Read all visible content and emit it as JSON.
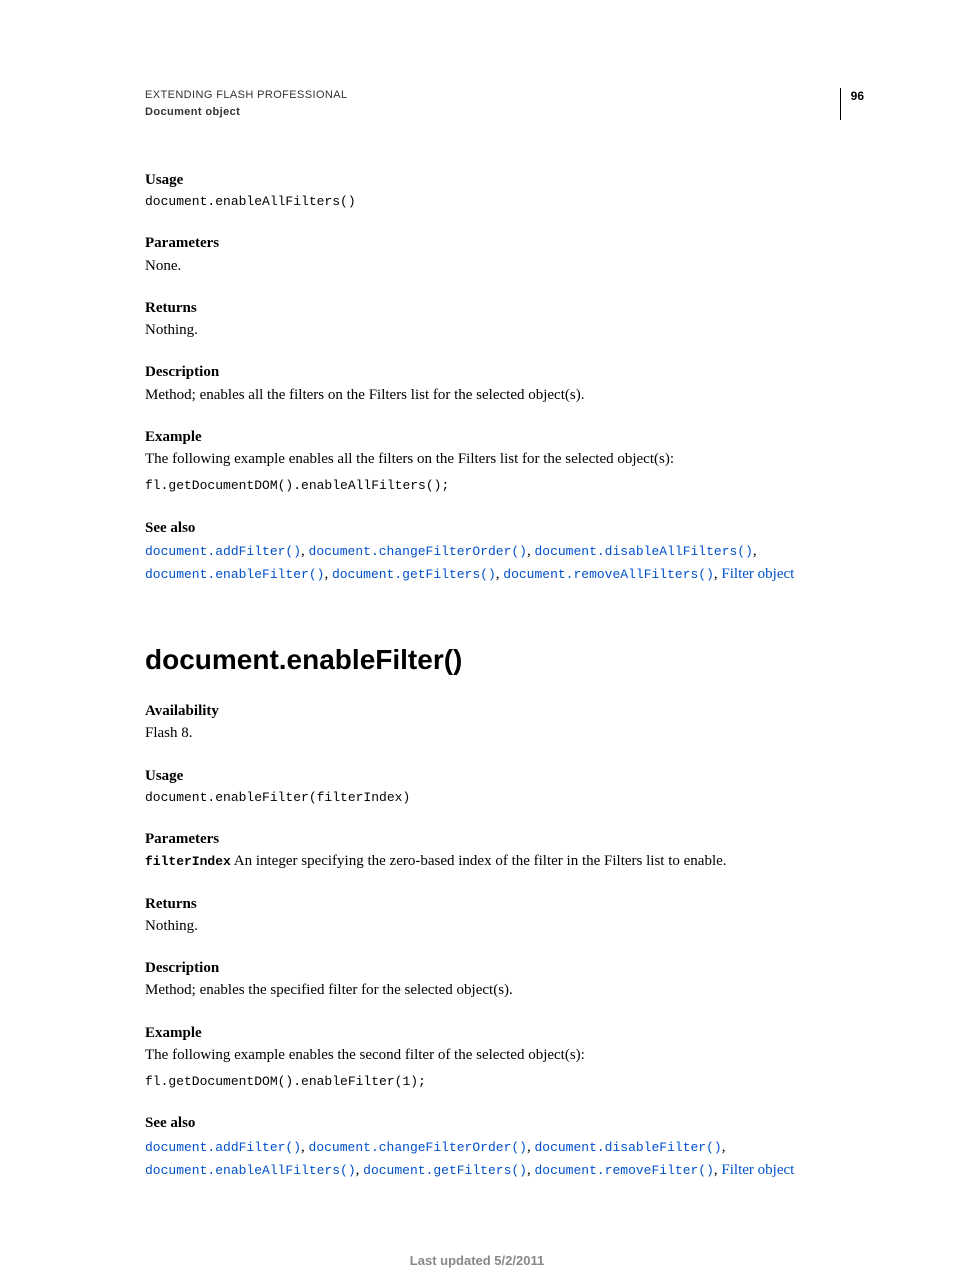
{
  "header": {
    "running_head": "EXTENDING FLASH PROFESSIONAL",
    "subhead": "Document object",
    "page_num": "96"
  },
  "sec1": {
    "usage_label": "Usage",
    "usage_code": "document.enableAllFilters()",
    "parameters_label": "Parameters",
    "parameters_text": "None.",
    "returns_label": "Returns",
    "returns_text": "Nothing.",
    "description_label": "Description",
    "description_text": "Method; enables all the filters on the Filters list for the selected object(s).",
    "example_label": "Example",
    "example_text": "The following example enables all the filters on the Filters list for the selected object(s):",
    "example_code": "fl.getDocumentDOM().enableAllFilters();",
    "seealso_label": "See also",
    "seealso_links": {
      "l0": "document.addFilter()",
      "l1": "document.changeFilterOrder()",
      "l2": "document.disableAllFilters()",
      "l3": "document.enableFilter()",
      "l4": "document.getFilters()",
      "l5": "document.removeAllFilters()",
      "l6": "Filter object"
    }
  },
  "sec2": {
    "title": "document.enableFilter()",
    "availability_label": "Availability",
    "availability_text": "Flash 8.",
    "usage_label": "Usage",
    "usage_code": "document.enableFilter(filterIndex)",
    "parameters_label": "Parameters",
    "param_name": "filterIndex",
    "param_desc": "  An integer specifying the zero-based index of the filter in the Filters list to enable.",
    "returns_label": "Returns",
    "returns_text": "Nothing.",
    "description_label": "Description",
    "description_text": "Method; enables the specified filter for the selected object(s).",
    "example_label": "Example",
    "example_text": "The following example enables the second filter of the selected object(s):",
    "example_code": "fl.getDocumentDOM().enableFilter(1);",
    "seealso_label": "See also",
    "seealso_links": {
      "l0": "document.addFilter()",
      "l1": "document.changeFilterOrder()",
      "l2": "document.disableFilter()",
      "l3": "document.enableAllFilters()",
      "l4": "document.getFilters()",
      "l5": "document.removeFilter()",
      "l6": "Filter object"
    }
  },
  "footer": "Last updated 5/2/2011"
}
